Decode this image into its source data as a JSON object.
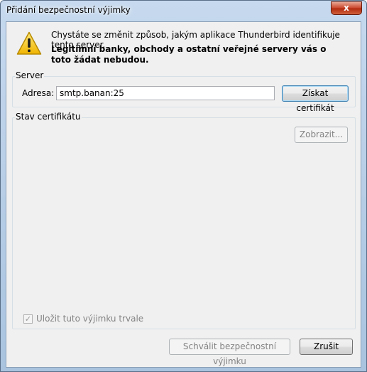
{
  "window": {
    "title": "Přidání bezpečnostní výjimky",
    "close_glyph": "x"
  },
  "warning": {
    "icon": "warning-icon",
    "line1": "Chystáte se změnit způsob, jakým aplikace Thunderbird identifikuje tento server.",
    "line2": "Legitimní banky, obchody a ostatní veřejné servery vás o toto žádat nebudou."
  },
  "server": {
    "group_label": "Server",
    "address_label": "Adresa:",
    "address_value": "smtp.banan:25",
    "get_cert_label": "Získat certifikát"
  },
  "cert_status": {
    "group_label": "Stav certifikátu",
    "view_label": "Zobrazit..."
  },
  "permanent": {
    "checked": true,
    "label": "Uložit tuto výjimku trvale"
  },
  "footer": {
    "confirm_label": "Schválit bezpečnostní výjimku",
    "cancel_label": "Zrušit"
  },
  "colors": {
    "accent": "#3c7fb1",
    "warning_yellow": "#f5c400"
  }
}
